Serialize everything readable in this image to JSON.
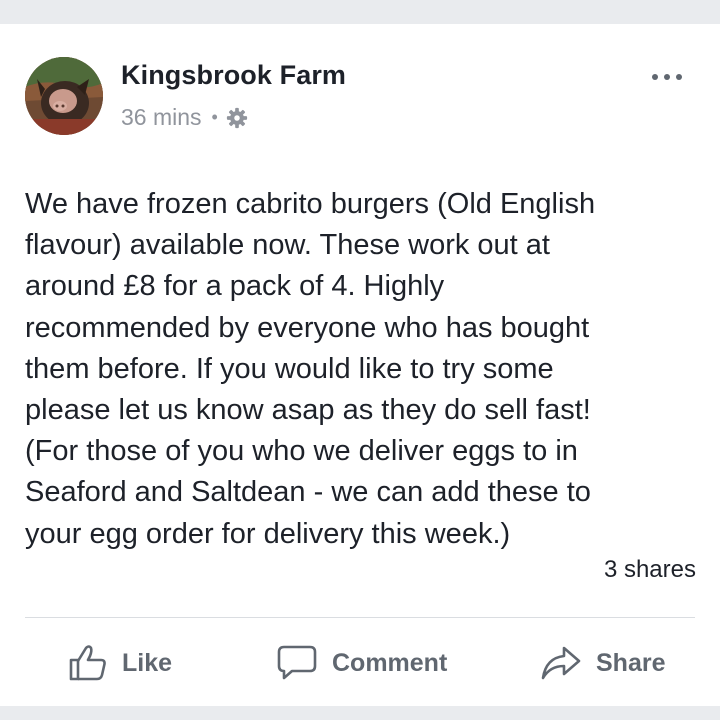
{
  "post": {
    "author": "Kingsbrook Farm",
    "time": "36 mins",
    "separator": "•",
    "privacy_icon": "gear-icon",
    "more_icon": "more-dots-icon",
    "text": "We have frozen cabrito burgers (Old English\nflavour) available now.  These work out at\naround £8 for a pack of 4.  Highly\nrecommended by everyone who has bought\nthem before.  If you would like to try some\nplease let us know asap as they do sell fast!\n(For those of you who we deliver eggs to in\nSeaford and Saltdean - we can add these to\nyour egg order for delivery this week.)",
    "shares": "3 shares"
  },
  "actions": {
    "like_label": "Like",
    "comment_label": "Comment",
    "share_label": "Share"
  },
  "colors": {
    "page_gray": "#e9ebee",
    "text_primary": "#1d2129",
    "text_secondary": "#90949c",
    "action_gray": "#606770"
  }
}
